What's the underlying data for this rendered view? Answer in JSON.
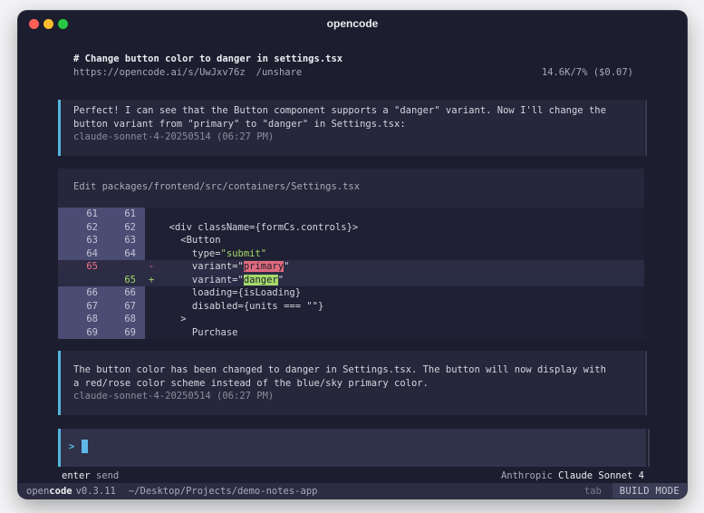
{
  "window": {
    "title": "opencode"
  },
  "header": {
    "title": "# Change button color to danger in settings.tsx",
    "share_url": "https://opencode.ai/s/UwJxv76z",
    "unshare": "/unshare",
    "usage": "14.6K/7% ($0.07)"
  },
  "messages": [
    {
      "lines": [
        "Perfect! I can see that the Button component supports a \"danger\" variant. Now I'll change the",
        "button variant from \"primary\" to \"danger\" in Settings.tsx:"
      ],
      "meta": "claude-sonnet-4-20250514 (06:27 PM)"
    },
    {
      "lines": [
        "The button color has been changed to danger in Settings.tsx. The button will now display with",
        "a red/rose color scheme instead of the blue/sky primary color."
      ],
      "meta": "claude-sonnet-4-20250514 (06:27 PM)"
    }
  ],
  "edit": {
    "title": "Edit packages/frontend/src/containers/Settings.tsx",
    "rows": [
      {
        "old": "61",
        "new": "61",
        "mark": "",
        "code": ""
      },
      {
        "old": "62",
        "new": "62",
        "mark": "",
        "code": "  <div className={formCs.controls}>"
      },
      {
        "old": "63",
        "new": "63",
        "mark": "",
        "code": "    <Button"
      },
      {
        "old": "64",
        "new": "64",
        "mark": "",
        "code": "      type=\"submit\""
      },
      {
        "old": "65",
        "new": "",
        "mark": "-",
        "code": "      variant=\"primary\""
      },
      {
        "old": "",
        "new": "65",
        "mark": "+",
        "code": "      variant=\"danger\""
      },
      {
        "old": "66",
        "new": "66",
        "mark": "",
        "code": "      loading={isLoading}"
      },
      {
        "old": "67",
        "new": "67",
        "mark": "",
        "code": "      disabled={units === \"\"}"
      },
      {
        "old": "68",
        "new": "68",
        "mark": "",
        "code": "    >"
      },
      {
        "old": "69",
        "new": "69",
        "mark": "",
        "code": "      Purchase"
      }
    ]
  },
  "input": {
    "prompt": ">",
    "value": ""
  },
  "hints": {
    "send_key": "enter",
    "send_label": "send",
    "provider": "Anthropic",
    "model": "Claude Sonnet 4"
  },
  "status": {
    "logo_open": "open",
    "logo_code": "code",
    "version": "v0.3.11",
    "path": "~/Desktop/Projects/demo-notes-app",
    "tab": "tab",
    "mode": "BUILD MODE"
  },
  "colors": {
    "accent": "#5fb8e6",
    "deleted": "#e06a7d",
    "added": "#a5d96a",
    "background": "#1c1d2e"
  }
}
